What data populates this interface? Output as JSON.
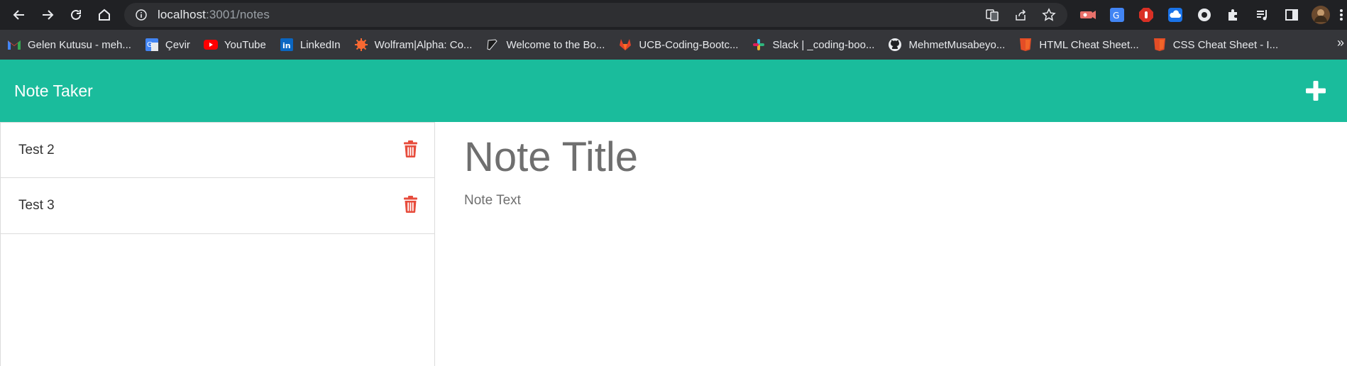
{
  "browser": {
    "url_host": "localhost",
    "url_path": ":3001/notes",
    "bookmarks": [
      {
        "label": "Gelen Kutusu - meh...",
        "icon": "gmail-icon"
      },
      {
        "label": "Çevir",
        "icon": "google-translate-icon"
      },
      {
        "label": "YouTube",
        "icon": "youtube-icon"
      },
      {
        "label": "LinkedIn",
        "icon": "linkedin-icon"
      },
      {
        "label": "Wolfram|Alpha: Co...",
        "icon": "wolfram-icon"
      },
      {
        "label": "Welcome to the Bo...",
        "icon": "book-icon"
      },
      {
        "label": "UCB-Coding-Bootc...",
        "icon": "gitlab-icon"
      },
      {
        "label": "Slack | _coding-boo...",
        "icon": "slack-icon"
      },
      {
        "label": "MehmetMusabeyo...",
        "icon": "github-icon"
      },
      {
        "label": "HTML Cheat Sheet...",
        "icon": "html5-icon"
      },
      {
        "label": "CSS Cheat Sheet - I...",
        "icon": "css-icon"
      }
    ],
    "more_label": "»"
  },
  "app": {
    "title": "Note Taker",
    "accent_color": "#1abc9c",
    "delete_color": "#e74c3c",
    "notes": [
      {
        "title": "Test 2"
      },
      {
        "title": "Test 3"
      }
    ],
    "editor": {
      "title_placeholder": "Note Title",
      "text_placeholder": "Note Text"
    }
  }
}
